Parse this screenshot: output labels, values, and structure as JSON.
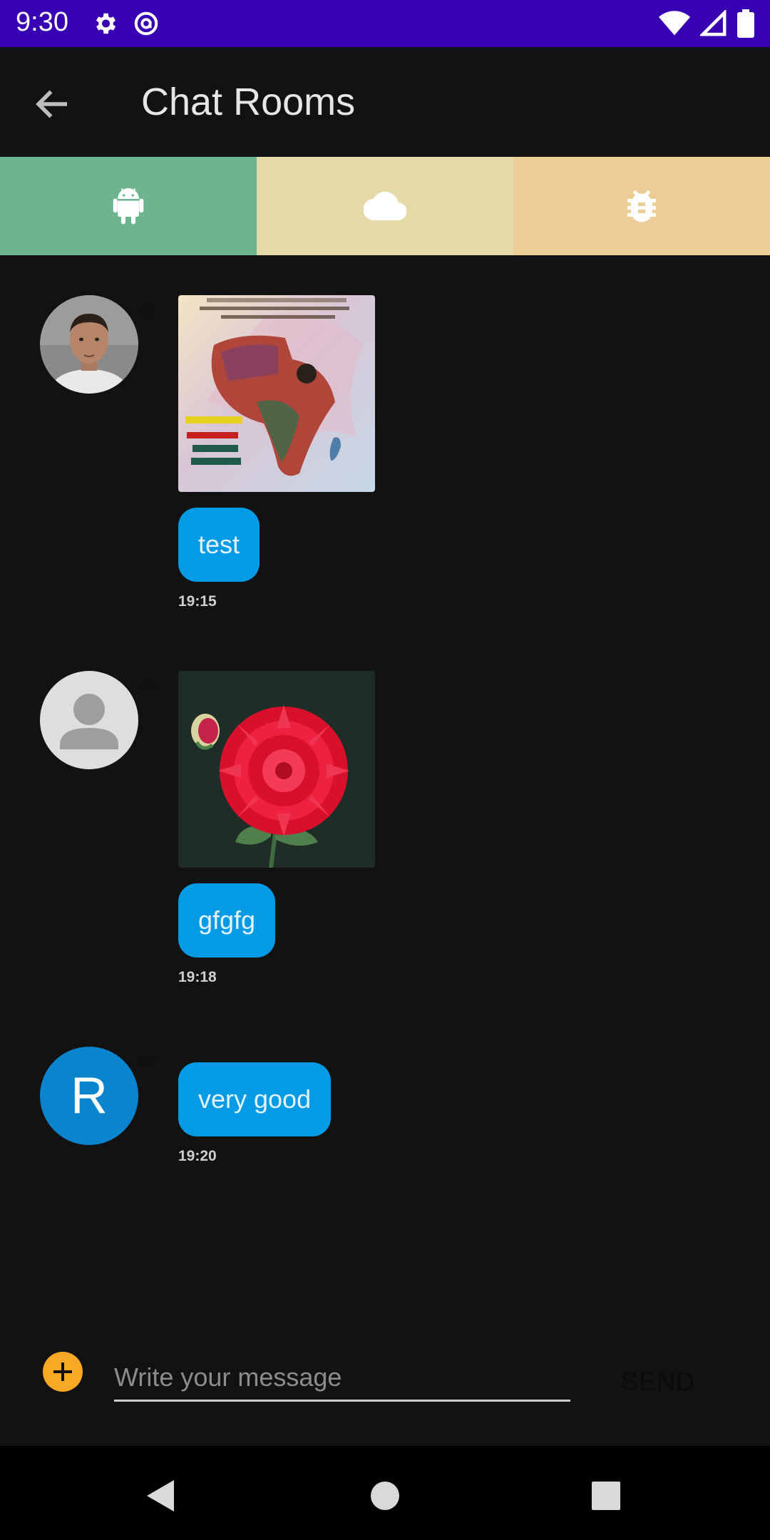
{
  "status_bar": {
    "time": "9:30",
    "icons": [
      "gear-icon",
      "circle-a-icon",
      "wifi-icon",
      "signal-icon",
      "battery-icon"
    ],
    "background": "#3700b3"
  },
  "app_bar": {
    "title": "Chat Rooms",
    "back_icon": "arrow-back-icon"
  },
  "tabs": [
    {
      "icon": "android-icon",
      "color": "#6db58f"
    },
    {
      "icon": "cloud-icon",
      "color": "#e6d9a8"
    },
    {
      "icon": "bug-icon",
      "color": "#ebcd95"
    }
  ],
  "messages": [
    {
      "avatar": "photo-avatar",
      "attachment": "poster-image",
      "text": "test",
      "time": "19:15"
    },
    {
      "avatar": "placeholder-avatar",
      "attachment": "flower-image",
      "text": "gfgfg",
      "time": "19:18"
    },
    {
      "avatar": "letter-avatar",
      "avatar_letter": "R",
      "text": "very good",
      "time": "19:20"
    }
  ],
  "composer": {
    "placeholder": "Write your message",
    "send_label": "SEND"
  },
  "colors": {
    "bubble": "#039be5",
    "accent": "#f9a825",
    "background": "#121212"
  }
}
